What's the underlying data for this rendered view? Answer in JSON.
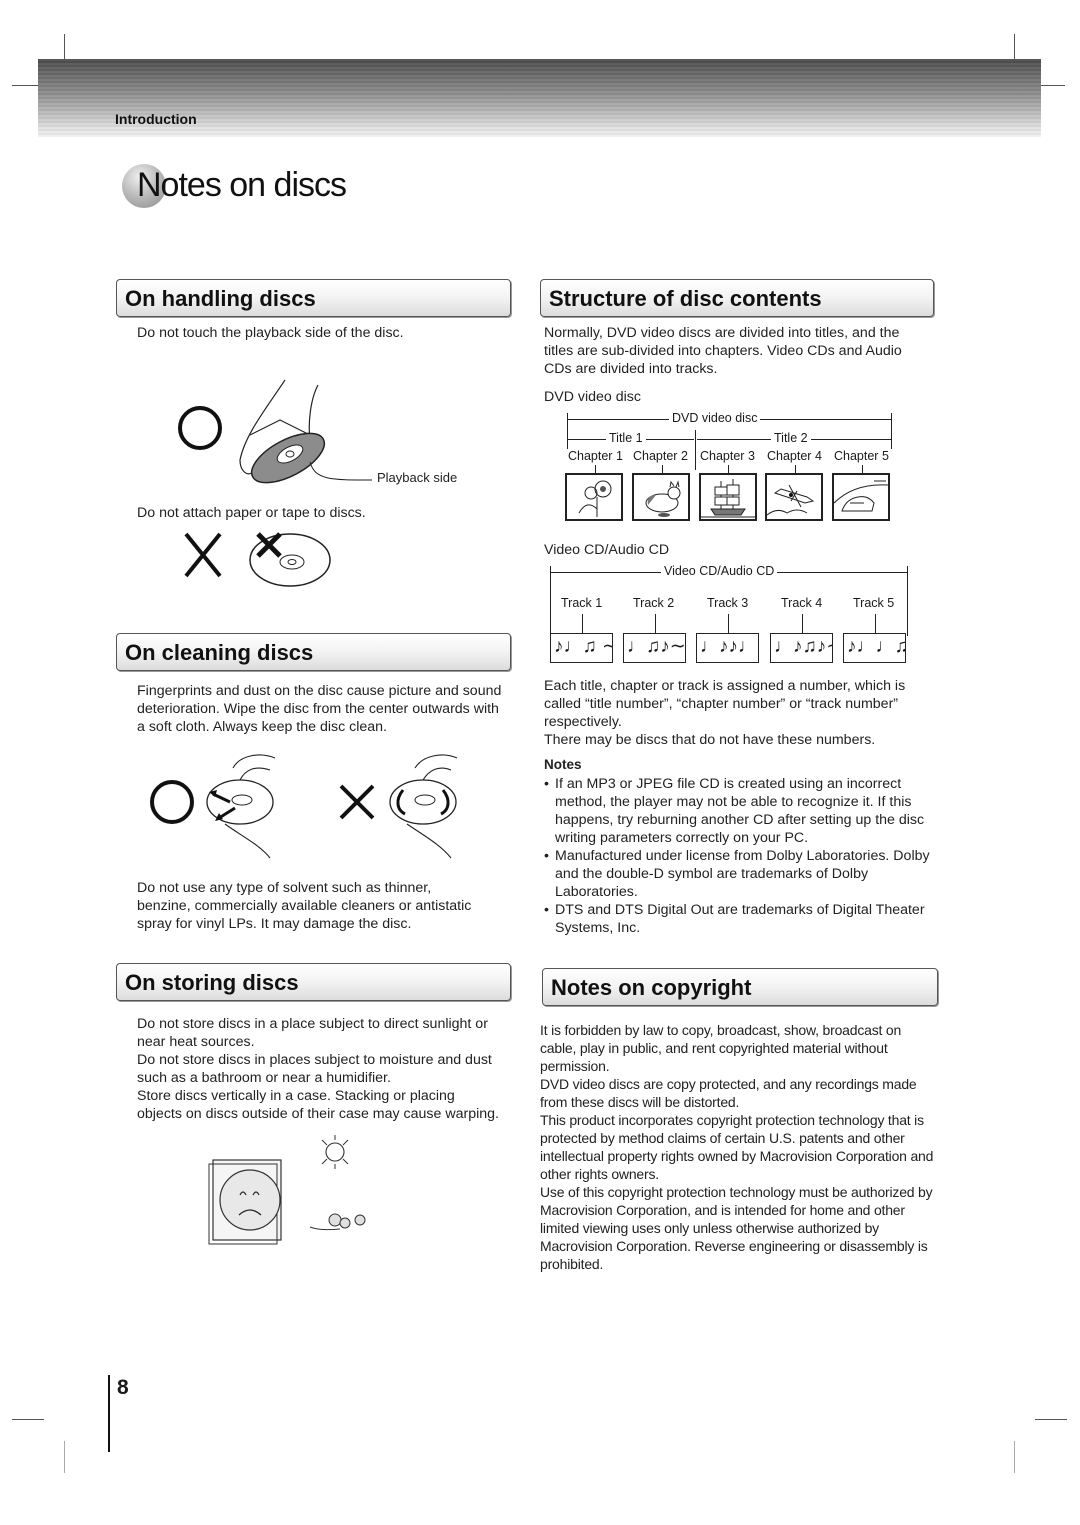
{
  "header": {
    "section_label": "Introduction",
    "page_title": "Notes on discs"
  },
  "handling": {
    "heading": "On handling discs",
    "line1": "Do not touch the playback side of the disc.",
    "callout": "Playback side",
    "line2": "Do not attach paper or tape to discs.",
    "ok_symbol": "○",
    "ng_symbol": "✕"
  },
  "cleaning": {
    "heading": "On cleaning discs",
    "para1": "Fingerprints and dust on the disc cause picture and sound deterioration. Wipe the disc from the center outwards with a soft cloth. Always keep the disc clean.",
    "para2": "Do not use any type of solvent such as thinner, benzine, commercially available cleaners or antistatic spray for vinyl LPs. It may damage the disc.",
    "ok_symbol": "○",
    "ng_symbol": "✕"
  },
  "storing": {
    "heading": "On storing discs",
    "paragraphs": [
      "Do not store discs in a place subject to direct sunlight or near heat sources.",
      "Do not store discs in places subject to moisture and dust such as a bathroom or near a humidifier.",
      "Store discs vertically in a case. Stacking or placing objects on discs outside of their case may cause warping."
    ]
  },
  "structure": {
    "heading": "Structure of disc contents",
    "intro": "Normally, DVD video discs are divided into titles, and the titles are sub-divided into chapters. Video CDs and Audio CDs are divided into tracks.",
    "dvd_caption": "DVD video disc",
    "dvd_diagram": {
      "span_label": "DVD video disc",
      "titles": [
        "Title 1",
        "Title 2"
      ],
      "chapters": [
        "Chapter 1",
        "Chapter 2",
        "Chapter 3",
        "Chapter 4",
        "Chapter 5"
      ],
      "thumbnails": [
        "flowers",
        "cat",
        "sailing-ship",
        "airplane",
        "car"
      ]
    },
    "cd_caption": "Video CD/Audio CD",
    "cd_diagram": {
      "span_label": "Video CD/Audio CD",
      "tracks": [
        "Track 1",
        "Track 2",
        "Track 3",
        "Track 4",
        "Track 5"
      ],
      "music": [
        "♪♩♫ ∼",
        "♩♫♪∼",
        "♩♪♪♩∼",
        "♩♪♫♪∼",
        "♪♩♩♫∼"
      ]
    },
    "after1": "Each title, chapter or track is assigned a number, which is called “title number”, “chapter number” or “track number” respectively.",
    "after2": "There may be discs that do not have these numbers.",
    "notes_title": "Notes",
    "notes": [
      "If an MP3 or JPEG file CD is created using an incorrect method, the player may not be able to recognize it. If this happens, try reburning another CD after setting up the disc writing parameters correctly on your PC.",
      "Manufactured under license from Dolby Laboratories. Dolby and the double-D symbol are trademarks of Dolby Laboratories.",
      "DTS and DTS Digital Out are trademarks of Digital Theater Systems, Inc."
    ]
  },
  "copyright": {
    "heading": "Notes on copyright",
    "paragraphs": [
      "It is forbidden by law to copy, broadcast, show, broadcast on cable, play in public, and rent copyrighted material without permission.",
      "DVD video discs are copy protected, and any recordings made from these discs will be distorted.",
      "This product incorporates copyright protection technology that is protected by method claims of certain U.S. patents and other intellectual property rights owned by Macrovision Corporation and other rights owners.",
      "Use of this copyright protection technology must be authorized by Macrovision Corporation, and is intended for home and other limited viewing uses only unless otherwise authorized by Macrovision Corporation. Reverse engineering or disassembly is prohibited."
    ]
  },
  "footer": {
    "page_number": "8"
  }
}
